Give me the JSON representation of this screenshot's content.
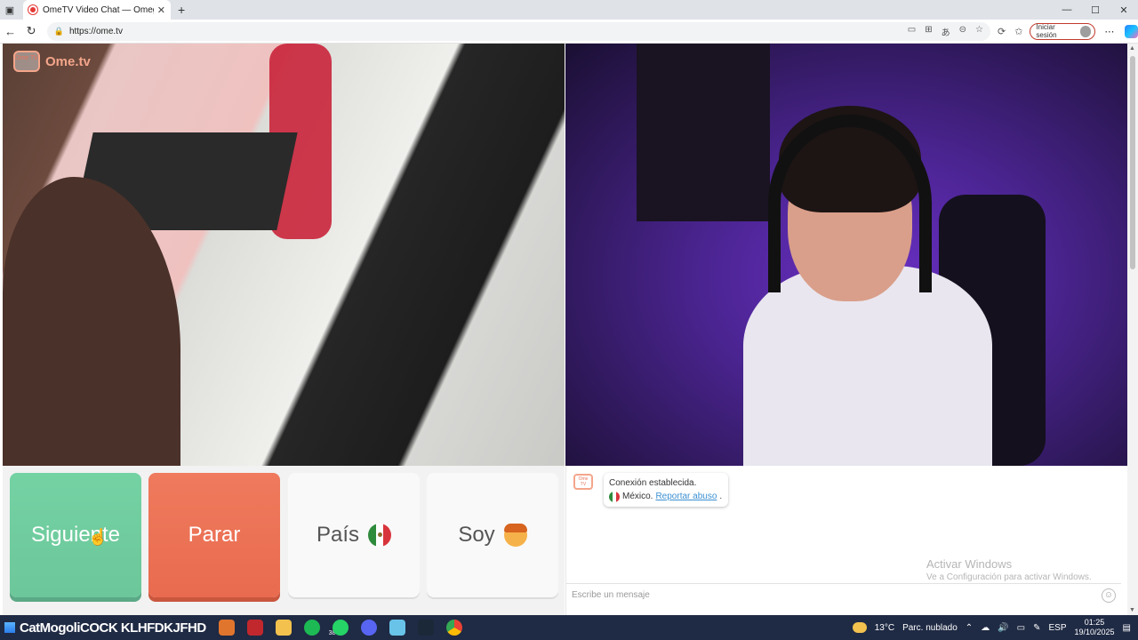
{
  "browser": {
    "tab_title": "OmeTV Video Chat — Omegle",
    "new_tab_symbol": "+",
    "url": "https://ome.tv",
    "signin_label": "Iniciar sesión",
    "window_controls": [
      "—",
      "☐",
      "✕"
    ]
  },
  "brand": {
    "name": "Ome.tv",
    "logo_text": "Ome TV"
  },
  "controls": {
    "next_label": "Siguiente",
    "stop_label": "Parar",
    "country_label": "País",
    "me_label": "Soy"
  },
  "chat": {
    "logo_text": "Ome TV",
    "system_message": "Conexión establecida.",
    "country": "México.",
    "report_link": "Reportar abuso",
    "report_suffix": ".",
    "input_placeholder": "Escribe un mensaje"
  },
  "watermark": {
    "line1": "Activar Windows",
    "line2": "Ve a Configuración para activar Windows."
  },
  "taskbar": {
    "overlay_text": "CatMogoliCOCK KLHFDKJFHD",
    "badge_count": "38",
    "weather_temp": "13°C",
    "weather_desc": "Parc. nublado",
    "language": "ESP",
    "time": "01:25",
    "date": "19/10/2025"
  },
  "colors": {
    "next_green": "#6cc79a",
    "stop_red": "#e96b4f",
    "brand_orange": "#f4a58a",
    "link_blue": "#3b8fd1"
  }
}
